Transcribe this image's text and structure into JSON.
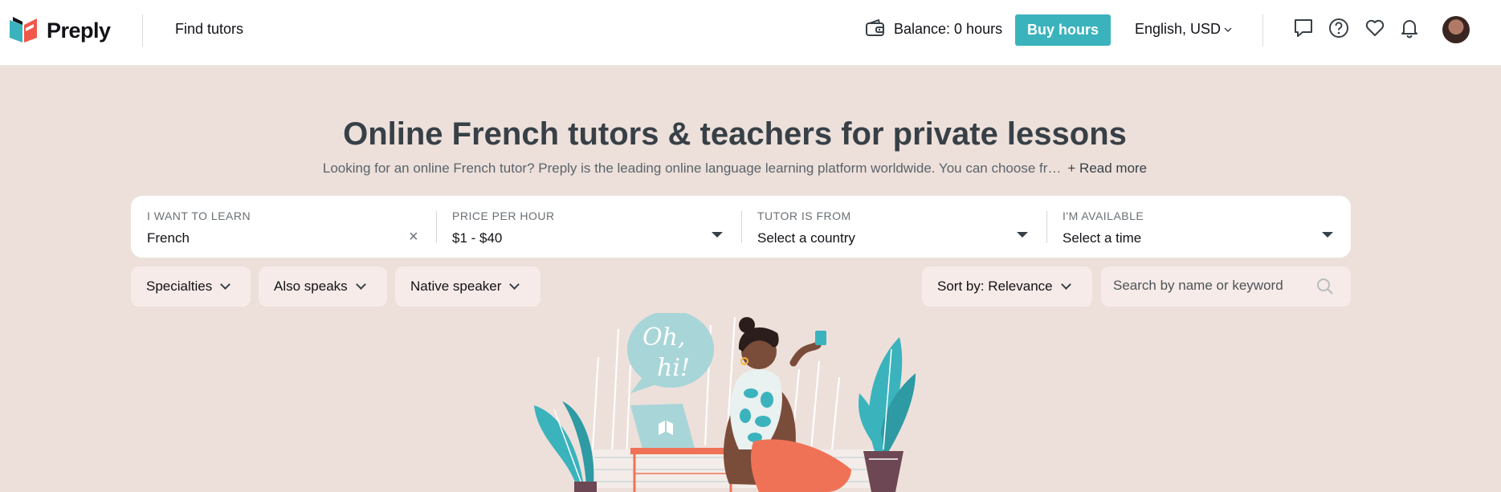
{
  "header": {
    "logo_text": "Preply",
    "find_tutors": "Find tutors",
    "balance": "Balance: 0 hours",
    "buy_hours": "Buy hours",
    "language_currency": "English, USD",
    "icons": [
      "wallet-icon",
      "messages-icon",
      "help-icon",
      "heart-icon",
      "bell-icon"
    ]
  },
  "hero": {
    "title": "Online French tutors & teachers for private lessons",
    "subtitle": "Looking for an online French tutor? Preply is the leading online language learning platform worldwide. You can choose fr…",
    "read_more": "+ Read more"
  },
  "search": {
    "learn_label": "I WANT TO LEARN",
    "learn_value": "French",
    "price_label": "PRICE PER HOUR",
    "price_value": "$1 - $40",
    "country_label": "TUTOR IS FROM",
    "country_value": "Select a country",
    "available_label": "I'M AVAILABLE",
    "available_value": "Select a time"
  },
  "filters": {
    "specialties": "Specialties",
    "also_speaks": "Also speaks",
    "native_speaker": "Native speaker",
    "sort_by": "Sort by: Relevance",
    "search_placeholder": "Search by name or keyword"
  },
  "illustration": {
    "speech_text_line1": "Oh,",
    "speech_text_line2": "hi!"
  },
  "colors": {
    "accent": "#3bb3bd",
    "page_bg": "#ede0db",
    "pill_bg": "#f6ebe8",
    "coral": "#f07256"
  }
}
